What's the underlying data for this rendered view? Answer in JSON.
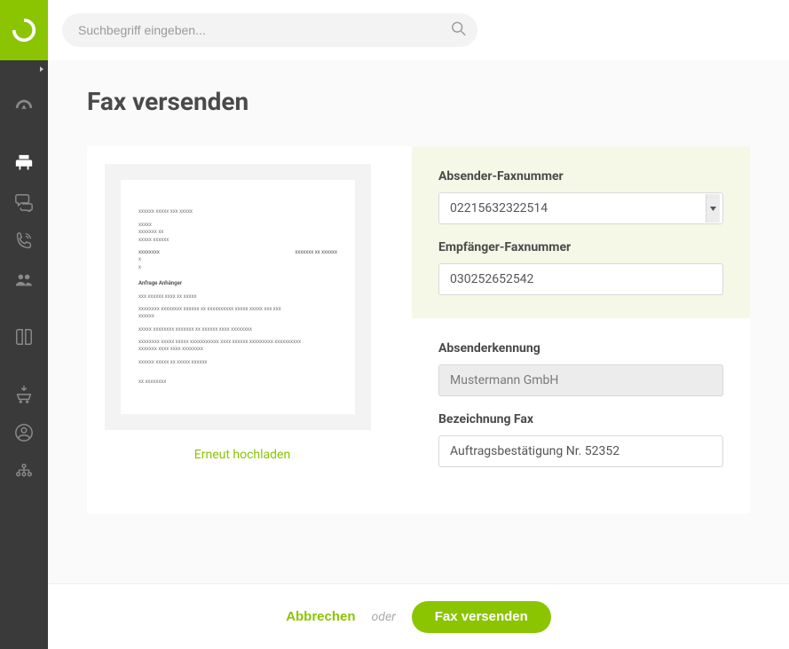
{
  "search": {
    "placeholder": "Suchbegriff eingeben..."
  },
  "page": {
    "title": "Fax versenden"
  },
  "preview": {
    "reupload": "Erneut hochladen"
  },
  "form": {
    "sender_fax_label": "Absender-Faxnummer",
    "sender_fax_value": "02215632322514",
    "recipient_fax_label": "Empfänger-Faxnummer",
    "recipient_fax_value": "030252652542",
    "sender_id_label": "Absenderkennung",
    "sender_id_value": "Mustermann GmbH",
    "fax_name_label": "Bezeichnung Fax",
    "fax_name_value": "Auftragsbestätigung Nr. 52352"
  },
  "footer": {
    "cancel": "Abbrechen",
    "or": "oder",
    "submit": "Fax versenden"
  },
  "doc": {
    "subject": "Anfrage Anhänger"
  }
}
